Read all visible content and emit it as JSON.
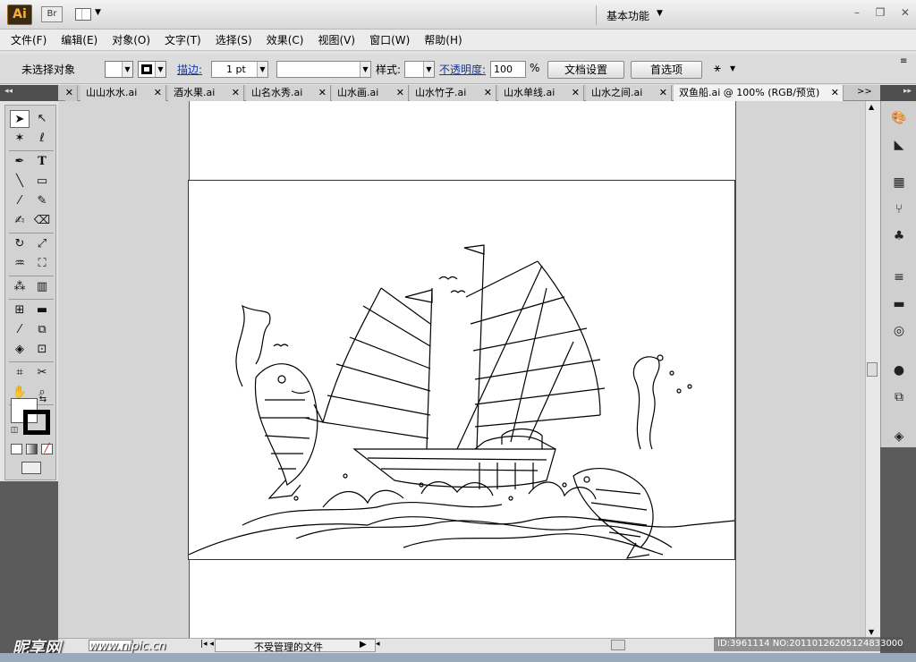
{
  "app": {
    "logo": "Ai",
    "bridge": "Br",
    "workspace": "基本功能"
  },
  "menu": [
    "文件(F)",
    "编辑(E)",
    "对象(O)",
    "文字(T)",
    "选择(S)",
    "效果(C)",
    "视图(V)",
    "窗口(W)",
    "帮助(H)"
  ],
  "control": {
    "selection": "未选择对象",
    "stroke_label": "描边:",
    "stroke_value": "1 pt",
    "style_label": "样式:",
    "opacity_label": "不透明度:",
    "opacity_value": "100",
    "percent": "%",
    "doc_setup": "文档设置",
    "prefs": "首选项"
  },
  "tabs": [
    "山山水水.ai",
    "酒水果.ai",
    "山名水秀.ai",
    "山水画.ai",
    "山水竹子.ai",
    "山水单线.ai",
    "山水之间.ai",
    "双鱼船.ai @ 100% (RGB/预览)"
  ],
  "status": {
    "text": "不受管理的文件"
  },
  "watermark": {
    "brand": "昵享网",
    "url": "www.nipic.cn",
    "id": "ID:3961114 NO:20110126205124833000"
  },
  "colors": {
    "accent": "#f6b23a",
    "toolbar_dark": "#5b5b5b"
  },
  "icons": [
    "selection-tool-icon",
    "direct-selection-tool-icon",
    "magic-wand-icon",
    "lasso-icon",
    "pen-icon",
    "type-icon",
    "line-icon",
    "rectangle-icon",
    "brush-icon",
    "pencil-icon",
    "blob-brush-icon",
    "eraser-icon",
    "rotate-icon",
    "scale-icon",
    "warp-icon",
    "free-transform-icon",
    "symbol-sprayer-icon",
    "graph-icon",
    "mesh-icon",
    "gradient-icon",
    "eyedropper-icon",
    "blend-icon",
    "live-paint-icon",
    "live-paint-select-icon",
    "artboard-icon",
    "slice-icon",
    "hand-icon",
    "zoom-icon"
  ]
}
